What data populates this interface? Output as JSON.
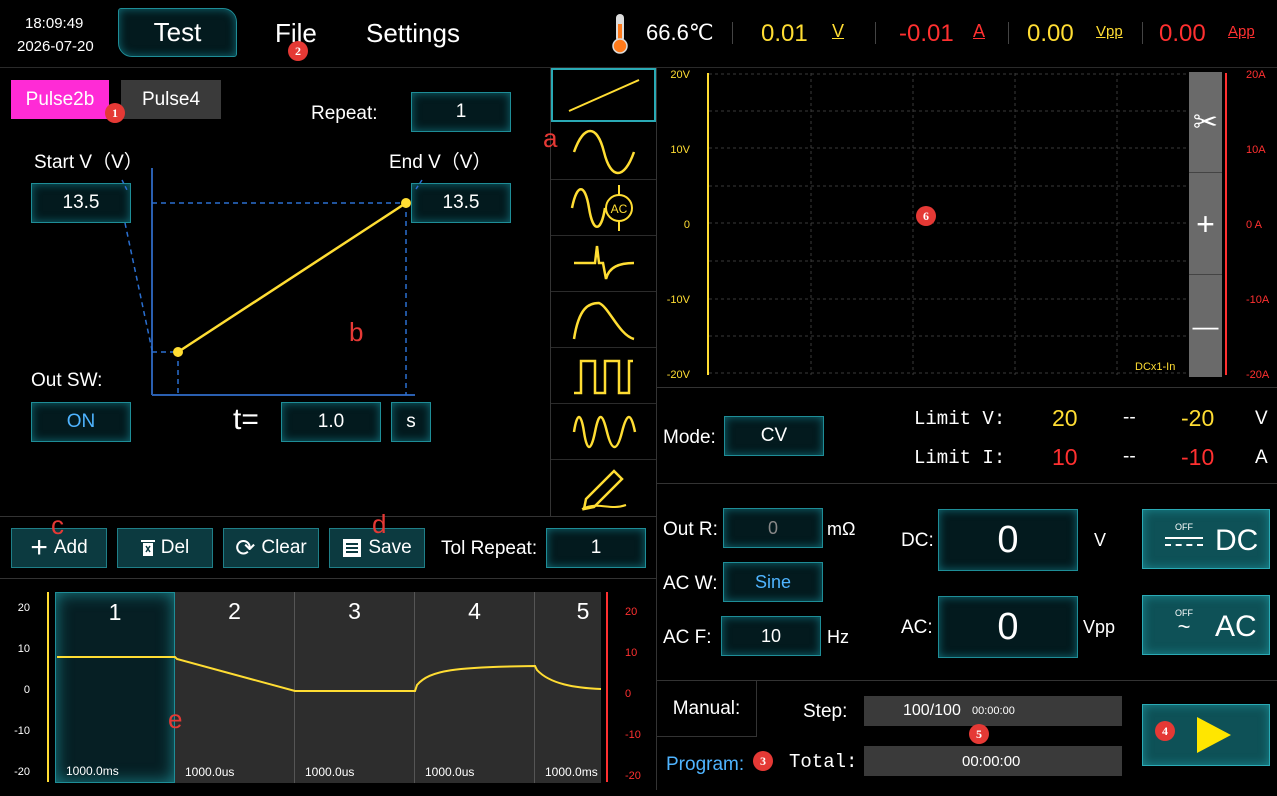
{
  "status": {
    "time": "18:09:49",
    "date": "2026-07-20"
  },
  "nav": {
    "test": "Test",
    "file": "File",
    "settings": "Settings"
  },
  "readouts": {
    "temperature": "66.6℃",
    "volt_value": "0.01",
    "volt_unit": "V",
    "amp_value": "-0.01",
    "amp_unit": "A",
    "vpp_value": "0.00",
    "vpp_unit": "Vpp",
    "app_value": "0.00",
    "app_unit": "App",
    "colors": {
      "yellow": "#ffdd33",
      "red": "#ff3030",
      "accent": "#1e8d97",
      "pink": "#ff2bd6"
    }
  },
  "pulse": {
    "tabs": [
      "Pulse2b",
      "Pulse4"
    ],
    "repeat_label": "Repeat:",
    "repeat_value": "1",
    "start_label": "Start V（V）",
    "start_value": "13.5",
    "end_label": "End V（V）",
    "end_value": "13.5",
    "outsw_label": "Out SW:",
    "outsw_value": "ON",
    "t_label": "t=",
    "t_value": "1.0",
    "t_unit": "s"
  },
  "waveforms": [
    "ramp-icon",
    "sine-icon",
    "sine-ac-icon",
    "spike-icon",
    "decay-icon",
    "square-icon",
    "chirp-icon",
    "pencil-icon"
  ],
  "list_toolbar": {
    "add": "Add",
    "del": "Del",
    "clear": "Clear",
    "save": "Save",
    "tol_label": "Tol Repeat:",
    "tol_value": "1"
  },
  "sequence": {
    "left_ticks": [
      "20",
      "10",
      "0",
      "-10",
      "-20"
    ],
    "right_ticks": [
      "20",
      "10",
      "0",
      "-10",
      "-20"
    ],
    "slots": [
      {
        "num": "1",
        "dur": "1000.0ms"
      },
      {
        "num": "2",
        "dur": "1000.0us"
      },
      {
        "num": "3",
        "dur": "1000.0us"
      },
      {
        "num": "4",
        "dur": "1000.0us"
      },
      {
        "num": "5",
        "dur": "1000.0ms"
      }
    ]
  },
  "scope": {
    "left_ticks": [
      "20V",
      "10V",
      "0",
      "-10V",
      "-20V"
    ],
    "right_ticks": [
      "20A",
      "10A",
      "0 A",
      "-10A",
      "-20A"
    ],
    "caption": "DCx1-In",
    "plus": "+",
    "minus": "—"
  },
  "mode": {
    "label": "Mode:",
    "value": "CV",
    "limit_v_label": "Limit V:",
    "limit_v_hi": "20",
    "limit_v_sep": "--",
    "limit_v_lo": "-20",
    "limit_v_unit": "V",
    "limit_i_label": "Limit I:",
    "limit_i_hi": "10",
    "limit_i_sep": "--",
    "limit_i_lo": "-10",
    "limit_i_unit": "A"
  },
  "output": {
    "outr_label": "Out R:",
    "outr_value": "0",
    "outr_unit": "mΩ",
    "acw_label": "AC W:",
    "acw_value": "Sine",
    "acf_label": "AC  F:",
    "acf_value": "10",
    "acf_unit": "Hz",
    "dc_label": "DC:",
    "dc_value": "0",
    "dc_unit": "V",
    "ac_label": "AC:",
    "ac_value": "0",
    "ac_unit": "Vpp",
    "dc_btn_state": "OFF",
    "dc_btn": "DC",
    "ac_btn_state": "OFF",
    "ac_btn": "AC"
  },
  "program": {
    "manual": "Manual:",
    "program": "Program:",
    "step_label": "Step:",
    "step_value": "100/100",
    "step_time": "00:00:00",
    "total_label": "Total:",
    "total_value": "00:00:00"
  },
  "annotations": {
    "n1": "1",
    "n2": "2",
    "n3": "3",
    "n4": "4",
    "n5": "5",
    "n6": "6",
    "a": "a",
    "b": "b",
    "c": "c",
    "d": "d",
    "e": "e"
  }
}
